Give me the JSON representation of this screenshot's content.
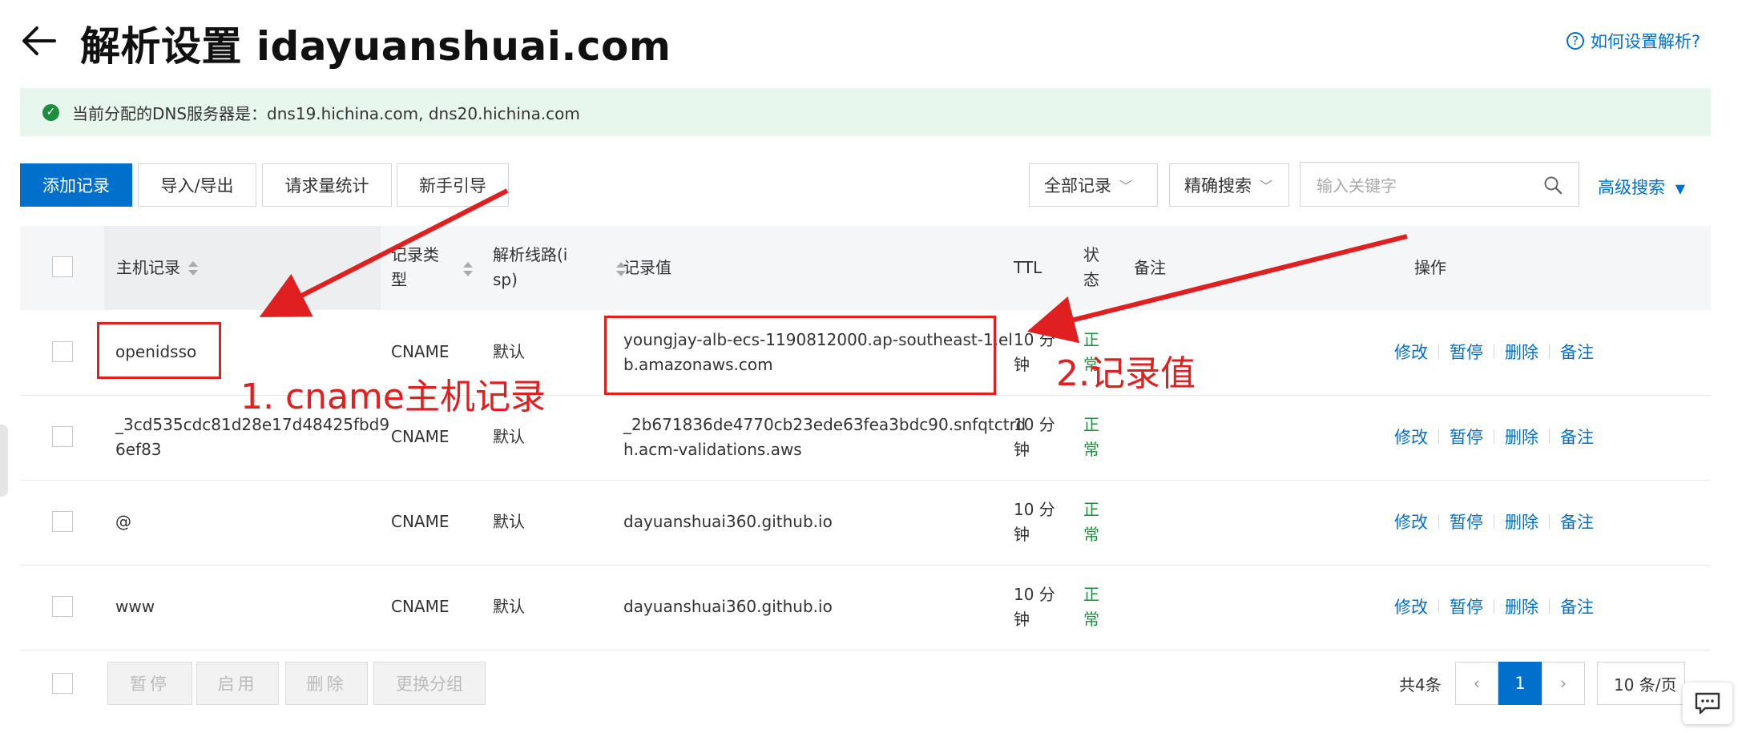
{
  "header": {
    "title": "解析设置 idayuanshuai.com",
    "help_label": "如何设置解析?"
  },
  "notice": {
    "text": "当前分配的DNS服务器是：dns19.hichina.com, dns20.hichina.com"
  },
  "toolbar": {
    "add_label": "添加记录",
    "import_label": "导入/导出",
    "stats_label": "请求量统计",
    "guide_label": "新手引导",
    "filter_label": "全部记录",
    "search_mode_label": "精确搜索",
    "search_placeholder": "输入关键字",
    "advanced_label": "高级搜索"
  },
  "table": {
    "headers": {
      "host": "主机记录",
      "type_l1": "记录类",
      "type_l2": "型",
      "line_l1": "解析线路(i",
      "line_l2": "sp)",
      "value": "记录值",
      "ttl": "TTL",
      "status_l1": "状",
      "status_l2": "态",
      "remark": "备注",
      "ops": "操作"
    },
    "rows": [
      {
        "host_l1": "openidsso",
        "host_l2": "",
        "type": "CNAME",
        "line": "默认",
        "value_l1": "youngjay-alb-ecs-1190812000.ap-southeast-1.el",
        "value_l2": "b.amazonaws.com",
        "ttl_l1": "10 分",
        "ttl_l2": "钟",
        "status_l1": "正",
        "status_l2": "常"
      },
      {
        "host_l1": "_3cd535cdc81d28e17d48425fbd9",
        "host_l2": "6ef83",
        "type": "CNAME",
        "line": "默认",
        "value_l1": "_2b671836de4770cb23ede63fea3bdc90.snfqtctrd",
        "value_l2": "h.acm-validations.aws",
        "ttl_l1": "10 分",
        "ttl_l2": "钟",
        "status_l1": "正",
        "status_l2": "常"
      },
      {
        "host_l1": "@",
        "host_l2": "",
        "type": "CNAME",
        "line": "默认",
        "value_l1": "dayuanshuai360.github.io",
        "value_l2": "",
        "ttl_l1": "10 分",
        "ttl_l2": "钟",
        "status_l1": "正",
        "status_l2": "常"
      },
      {
        "host_l1": "www",
        "host_l2": "",
        "type": "CNAME",
        "line": "默认",
        "value_l1": "dayuanshuai360.github.io",
        "value_l2": "",
        "ttl_l1": "10 分",
        "ttl_l2": "钟",
        "status_l1": "正",
        "status_l2": "常"
      }
    ],
    "ops": {
      "edit": "修改",
      "pause": "暂停",
      "delete": "删除",
      "note": "备注"
    }
  },
  "footer": {
    "pause_label": "暂停",
    "enable_label": "启用",
    "delete_label": "删除",
    "group_label": "更换分组",
    "total_label": "共4条",
    "current_page": "1",
    "page_size_label": "10 条/页"
  },
  "annotations": {
    "label1": "1. cname主机记录",
    "label2": "2.记录值"
  },
  "colors": {
    "accent": "#0070cc",
    "success": "#1e8e3e",
    "annotation": "#e02020",
    "notice_bg": "#e8f7ee"
  }
}
